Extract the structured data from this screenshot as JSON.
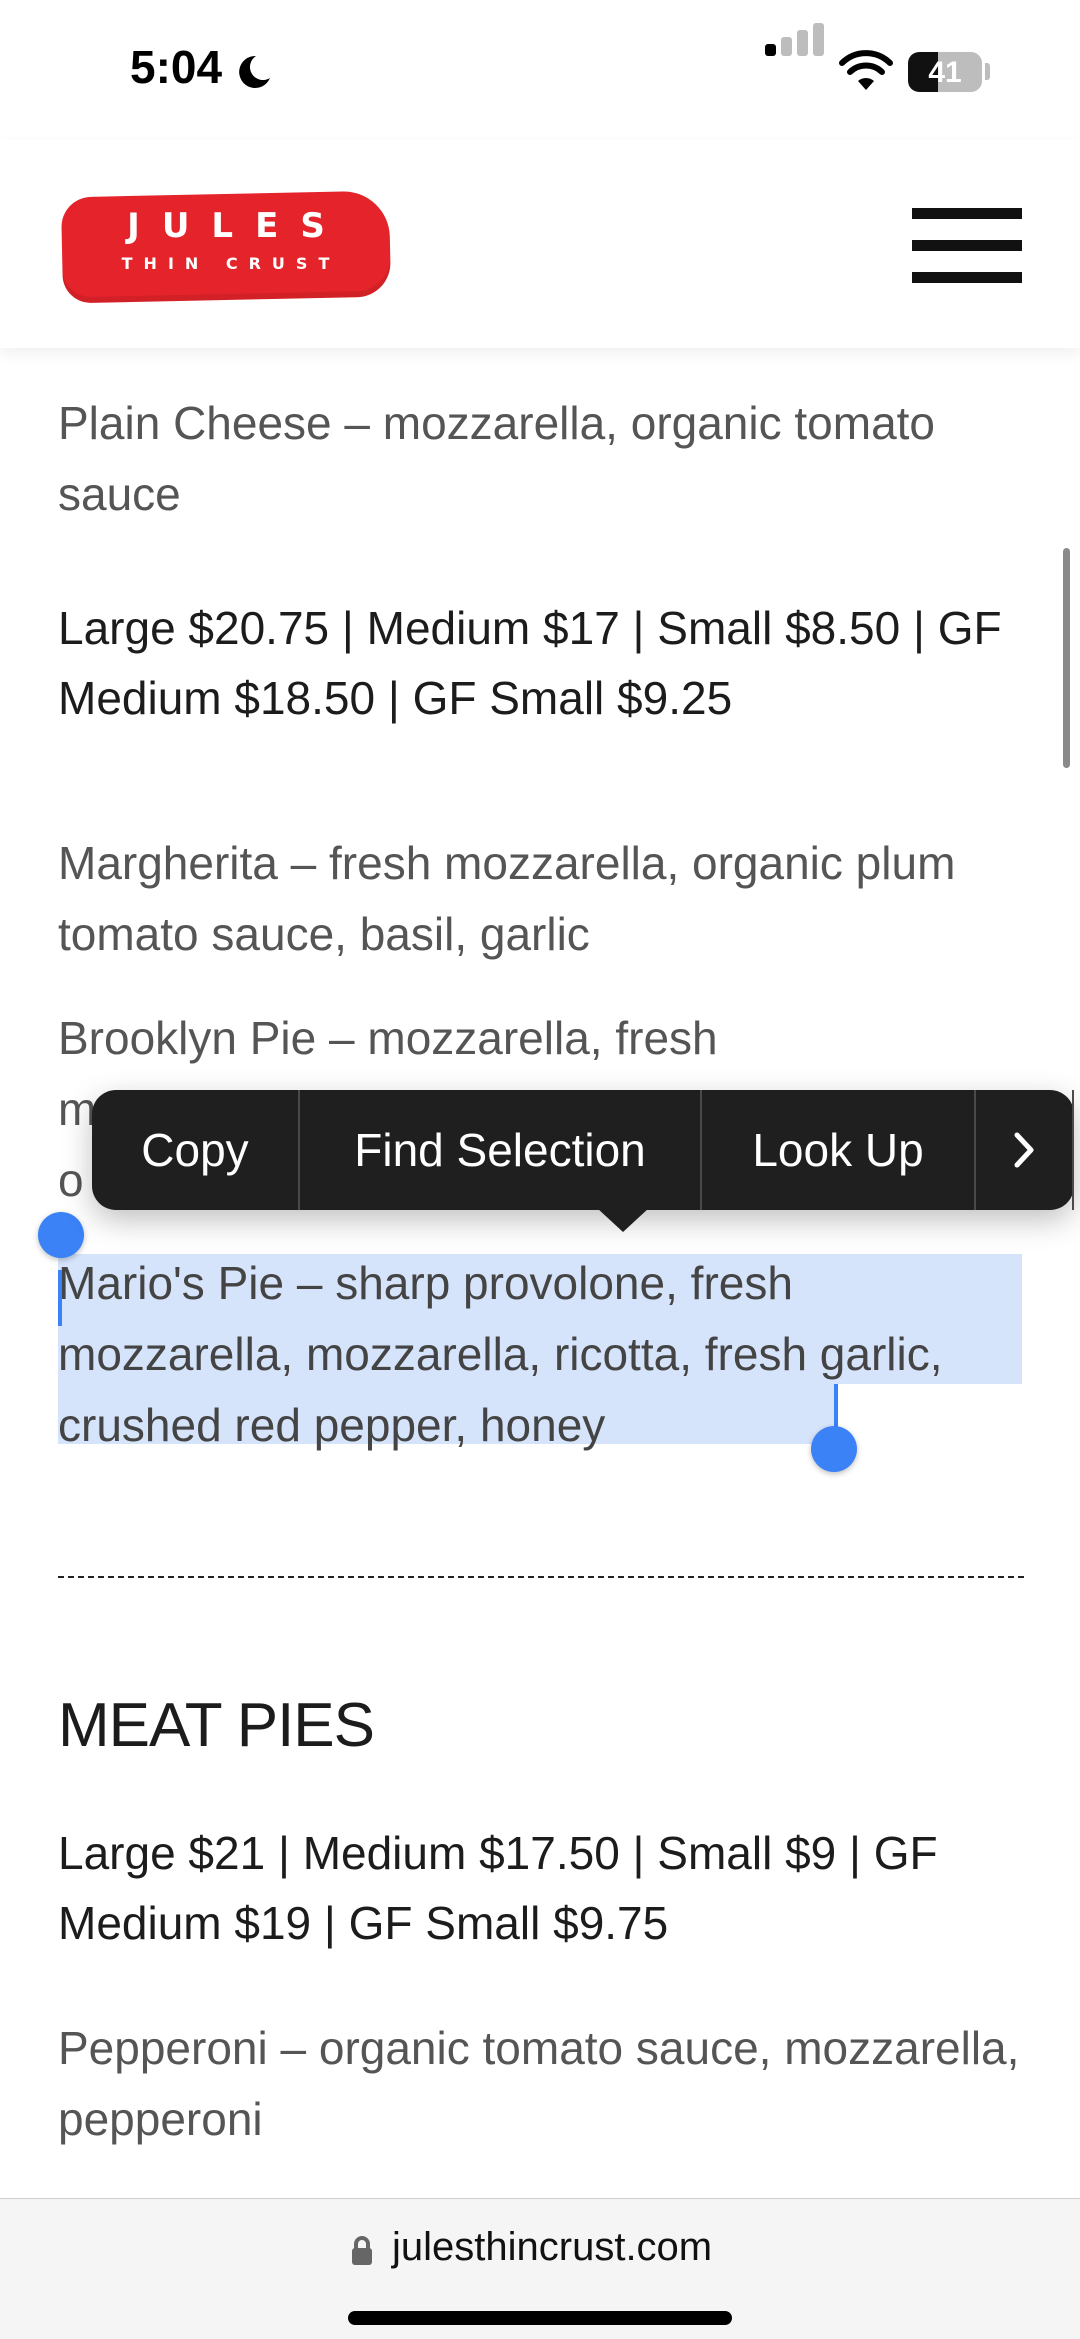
{
  "status_bar": {
    "time": "5:04",
    "battery_label": "41",
    "battery_level": 0.41,
    "signal_bars_active": 1,
    "signal_bars_total": 4,
    "icons": [
      "moon-icon",
      "signal-icon",
      "wifi-icon",
      "battery-icon"
    ]
  },
  "header": {
    "logo_line1": "JULES",
    "logo_line2": "THIN CRUST",
    "logo_color": "#e4232b",
    "menu_icon": "hamburger-menu-icon"
  },
  "menu": {
    "plain_cheese": "Plain Cheese – mozzarella, organic tomato sauce",
    "cheese_prices": "Large $20.75 | Medium $17 | Small $8.50 | GF Medium $18.50 | GF Small $9.25",
    "margherita": "Margherita – fresh mozzarella, organic plum tomato sauce, basil, garlic",
    "brooklyn_line1": "Brooklyn Pie – mozzarella, fresh",
    "brooklyn_line2_start": "m",
    "brooklyn_line3_start": "o",
    "marios_pie": "Mario's Pie – sharp provolone, fresh mozzarella, mozzarella, ricotta, fresh garlic, crushed red pepper, honey",
    "meat_pies_heading": "MEAT PIES",
    "meat_prices": "Large $21 | Medium $17.50 | Small $9 | GF Medium $19 | GF Small $9.75",
    "pepperoni": "Pepperoni – organic tomato sauce, mozzarella, pepperoni"
  },
  "context_menu": {
    "copy": "Copy",
    "find_selection": "Find Selection",
    "look_up": "Look Up",
    "more_icon": "chevron-right-icon"
  },
  "selection": {
    "color": "#d6e4fb",
    "handle_color": "#3b82f6"
  },
  "url_bar": {
    "url": "julesthincrust.com",
    "lock_icon": "lock-icon"
  }
}
